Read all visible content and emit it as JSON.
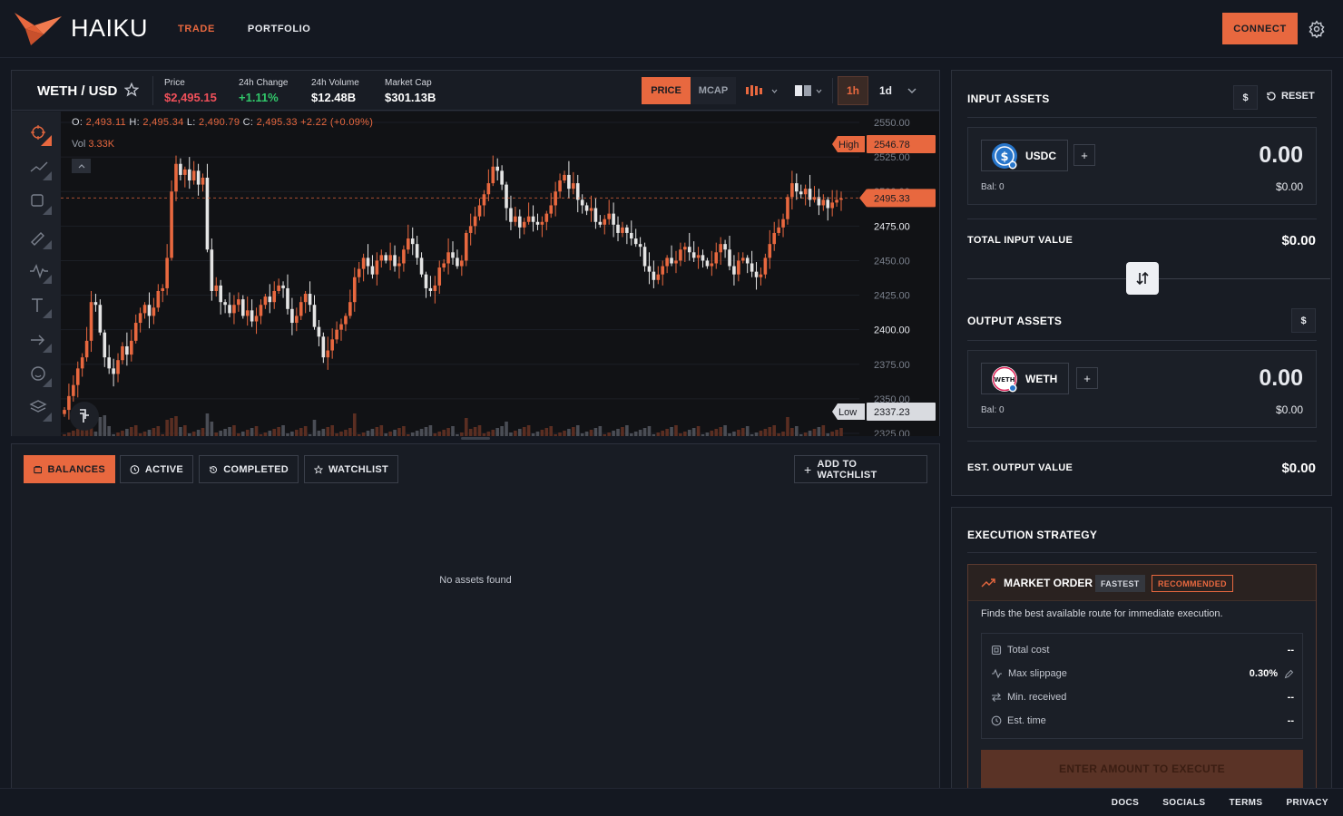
{
  "app": {
    "name": "HAIKU"
  },
  "nav": {
    "trade": "TRADE",
    "portfolio": "PORTFOLIO",
    "connect": "CONNECT"
  },
  "pair": {
    "name": "WETH / USD"
  },
  "stats": {
    "price_label": "Price",
    "price_value": "$2,495.15",
    "change_label": "24h Change",
    "change_value": "+1.11%",
    "volume_label": "24h Volume",
    "volume_value": "$12.48B",
    "mcap_label": "Market Cap",
    "mcap_value": "$301.13B"
  },
  "chart_controls": {
    "price": "PRICE",
    "mcap": "MCAP",
    "tf_1h": "1h",
    "tf_1d": "1d"
  },
  "ohlc": {
    "o_label": "O:",
    "o": "2,493.11",
    "h_label": "H:",
    "h": "2,495.34",
    "l_label": "L:",
    "l": "2,490.79",
    "c_label": "C:",
    "c": "2,495.33",
    "chg": "+2.22",
    "chg_pct": "(+0.09%)",
    "vol_label": "Vol",
    "vol": "3.33K"
  },
  "chart_data": {
    "type": "candlestick",
    "y_ticks": [
      "2550.00",
      "2525.00",
      "2500.00",
      "2475.00",
      "2450.00",
      "2425.00",
      "2400.00",
      "2375.00",
      "2350.00",
      "2325.00"
    ],
    "ylim": [
      2325,
      2550
    ],
    "high_label": "High",
    "high": "2546.78",
    "low_label": "Low",
    "low": "2337.23",
    "last": "2495.33",
    "colors": {
      "up": "#e8683f",
      "down": "#e4e4e4",
      "grid": "#1c1f26"
    },
    "closes": [
      2342,
      2352,
      2360,
      2372,
      2380,
      2392,
      2420,
      2418,
      2398,
      2380,
      2372,
      2368,
      2378,
      2388,
      2382,
      2392,
      2405,
      2412,
      2418,
      2410,
      2416,
      2428,
      2430,
      2452,
      2500,
      2520,
      2512,
      2516,
      2508,
      2515,
      2505,
      2510,
      2458,
      2428,
      2432,
      2420,
      2418,
      2412,
      2418,
      2422,
      2410,
      2414,
      2406,
      2410,
      2418,
      2424,
      2420,
      2428,
      2432,
      2430,
      2415,
      2405,
      2410,
      2420,
      2426,
      2418,
      2402,
      2395,
      2380,
      2385,
      2393,
      2400,
      2404,
      2410,
      2420,
      2438,
      2444,
      2452,
      2446,
      2440,
      2450,
      2454,
      2450,
      2454,
      2446,
      2448,
      2458,
      2466,
      2462,
      2452,
      2440,
      2430,
      2428,
      2432,
      2445,
      2448,
      2456,
      2452,
      2446,
      2450,
      2470,
      2475,
      2482,
      2490,
      2498,
      2506,
      2518,
      2515,
      2505,
      2488,
      2478,
      2482,
      2474,
      2478,
      2482,
      2478,
      2476,
      2478,
      2484,
      2490,
      2500,
      2508,
      2512,
      2502,
      2506,
      2494,
      2490,
      2486,
      2488,
      2478,
      2476,
      2480,
      2484,
      2476,
      2470,
      2474,
      2470,
      2466,
      2462,
      2460,
      2446,
      2442,
      2436,
      2440,
      2446,
      2452,
      2448,
      2450,
      2458,
      2460,
      2456,
      2452,
      2454,
      2450,
      2446,
      2448,
      2456,
      2462,
      2458,
      2446,
      2440,
      2450,
      2452,
      2448,
      2442,
      2438,
      2440,
      2452,
      2462,
      2470,
      2474,
      2480,
      2496,
      2506,
      2500,
      2498,
      2502,
      2494,
      2496,
      2490,
      2494,
      2488,
      2492,
      2494,
      2495
    ]
  },
  "tabs": {
    "balances": "BALANCES",
    "active": "ACTIVE",
    "completed": "COMPLETED",
    "watchlist": "WATCHLIST",
    "add_watchlist": "ADD TO WATCHLIST"
  },
  "empty_msg": "No assets found",
  "input": {
    "title": "INPUT ASSETS",
    "dollar": "$",
    "reset": "RESET",
    "token": "USDC",
    "amount": "0.00",
    "bal": "Bal: 0",
    "usd": "$0.00",
    "total_label": "TOTAL INPUT VALUE",
    "total_value": "$0.00"
  },
  "output": {
    "title": "OUTPUT ASSETS",
    "dollar": "$",
    "token": "WETH",
    "amount": "0.00",
    "bal": "Bal: 0",
    "usd": "$0.00",
    "est_label": "EST. OUTPUT VALUE",
    "est_value": "$0.00"
  },
  "strategy": {
    "title": "EXECUTION STRATEGY",
    "name": "MARKET ORDER",
    "badge_fast": "FASTEST",
    "badge_rec": "RECOMMENDED",
    "desc": "Finds the best available route for immediate execution.",
    "rows": [
      {
        "label": "Total cost",
        "value": "--"
      },
      {
        "label": "Max slippage",
        "value": "0.30%"
      },
      {
        "label": "Min. received",
        "value": "--"
      },
      {
        "label": "Est. time",
        "value": "--"
      }
    ],
    "exec": "ENTER AMOUNT TO EXECUTE"
  },
  "footer": {
    "docs": "DOCS",
    "socials": "SOCIALS",
    "terms": "TERMS",
    "privacy": "PRIVACY"
  }
}
